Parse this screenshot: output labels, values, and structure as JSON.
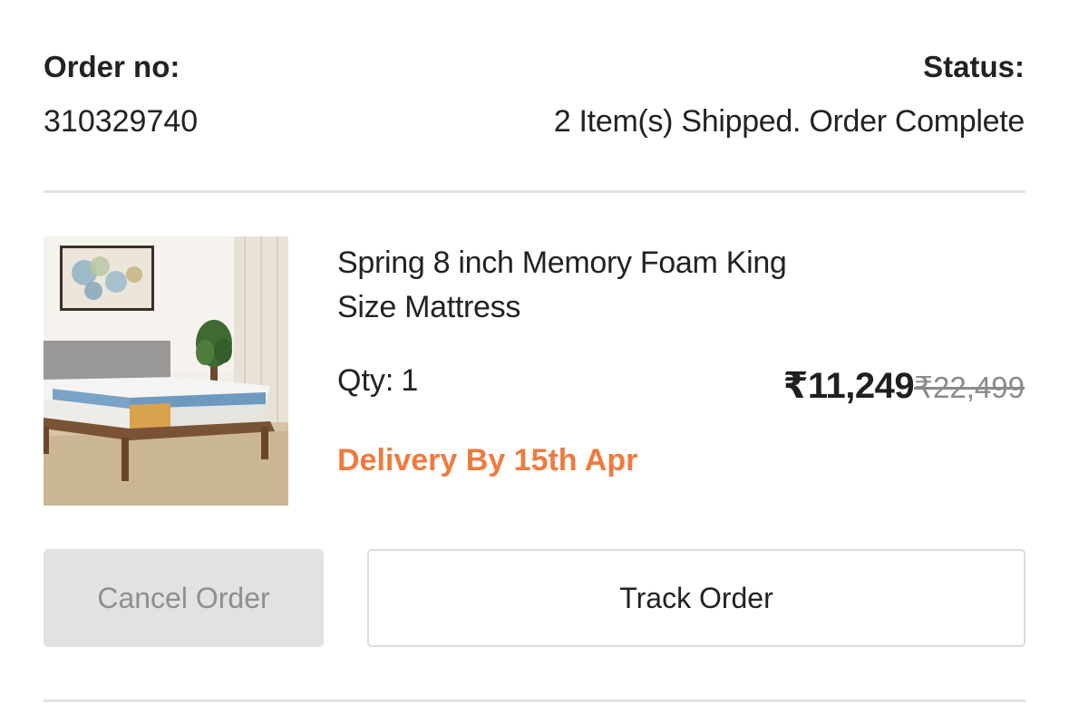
{
  "order": {
    "number_label": "Order no:",
    "number": "310329740",
    "status_label": "Status:",
    "status": "2 Item(s) Shipped. Order Complete"
  },
  "item": {
    "name": "Spring 8 inch Memory Foam King Size Mattress",
    "qty_label": "Qty:",
    "qty": "1",
    "price": "₹11,249",
    "mrp": "₹22,499",
    "delivery": "Delivery By 15th Apr"
  },
  "actions": {
    "cancel_label": "Cancel Order",
    "track_label": "Track Order"
  },
  "colors": {
    "accent_orange": "#f07a3e",
    "divider": "#e3e3e3",
    "disabled_button_bg": "#e2e2e2",
    "disabled_button_text": "#8f8f8f"
  }
}
